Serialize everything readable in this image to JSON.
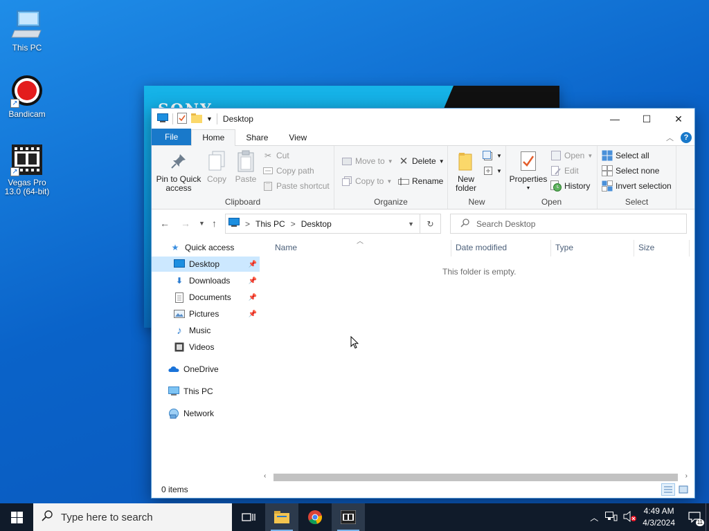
{
  "desktop": {
    "icons": [
      {
        "label": "This PC"
      },
      {
        "label": "Bandicam"
      },
      {
        "label": "Vegas Pro 13.0 (64-bit)"
      }
    ],
    "background_window_text": "SONY"
  },
  "explorer": {
    "title": "Desktop",
    "window_controls": {
      "minimize": "—",
      "maximize": "☐",
      "close": "✕"
    },
    "tabs": {
      "file": "File",
      "home": "Home",
      "share": "Share",
      "view": "View"
    },
    "ribbon": {
      "clipboard": {
        "label": "Clipboard",
        "pin": "Pin to Quick access",
        "copy": "Copy",
        "paste": "Paste",
        "cut": "Cut",
        "copy_path": "Copy path",
        "paste_shortcut": "Paste shortcut"
      },
      "organize": {
        "label": "Organize",
        "move_to": "Move to",
        "copy_to": "Copy to",
        "delete": "Delete",
        "rename": "Rename"
      },
      "new": {
        "label": "New",
        "new_folder": "New folder"
      },
      "open": {
        "label": "Open",
        "properties": "Properties",
        "open": "Open",
        "edit": "Edit",
        "history": "History"
      },
      "select": {
        "label": "Select",
        "select_all": "Select all",
        "select_none": "Select none",
        "invert": "Invert selection"
      }
    },
    "address": {
      "root": "This PC",
      "current": "Desktop",
      "separator": ">"
    },
    "search": {
      "placeholder": "Search Desktop"
    },
    "nav": {
      "quick_access": "Quick access",
      "desktop": "Desktop",
      "downloads": "Downloads",
      "documents": "Documents",
      "pictures": "Pictures",
      "music": "Music",
      "videos": "Videos",
      "onedrive": "OneDrive",
      "this_pc": "This PC",
      "network": "Network"
    },
    "columns": {
      "name": "Name",
      "date": "Date modified",
      "type": "Type",
      "size": "Size"
    },
    "empty_message": "This folder is empty.",
    "status": "0 items"
  },
  "taskbar": {
    "search_placeholder": "Type here to search",
    "time": "4:49 AM",
    "date": "4/3/2024",
    "notification_count": "11"
  },
  "colors": {
    "accent": "#1979ca",
    "selection": "#cce8ff",
    "taskbar": "#101b2a"
  }
}
